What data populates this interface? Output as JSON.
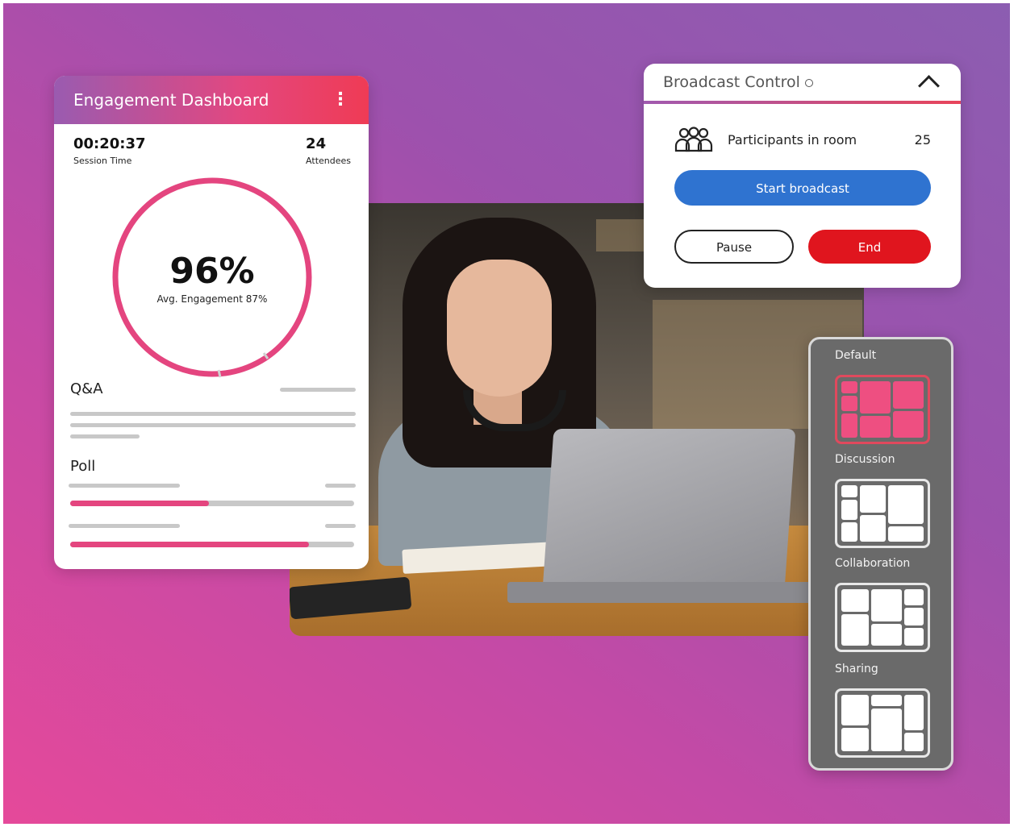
{
  "engagement": {
    "title": "Engagement Dashboard",
    "session_time": "00:20:37",
    "session_time_label": "Session Time",
    "attendees": "24",
    "attendees_label": "Attendees",
    "engagement_percent": "96%",
    "avg_engagement": "Avg. Engagement 87%",
    "qa_label": "Q&A",
    "poll_label": "Poll",
    "poll_results": [
      0.49,
      0.84
    ],
    "accent_color": "#e4457f"
  },
  "broadcast": {
    "title": "Broadcast Control",
    "participants_label": "Participants in room",
    "participants_count": "25",
    "start_label": "Start broadcast",
    "pause_label": "Pause",
    "end_label": "End",
    "start_color": "#2f73d0",
    "end_color": "#e0151e"
  },
  "layouts": {
    "items": [
      {
        "label": "Default",
        "active": true
      },
      {
        "label": "Discussion",
        "active": false
      },
      {
        "label": "Collaboration",
        "active": false
      },
      {
        "label": "Sharing",
        "active": false
      }
    ]
  },
  "icons": {
    "menu": "vertical-dots-icon",
    "info": "info-icon",
    "collapse": "chevron-up-icon",
    "participants": "people-group-icon"
  }
}
